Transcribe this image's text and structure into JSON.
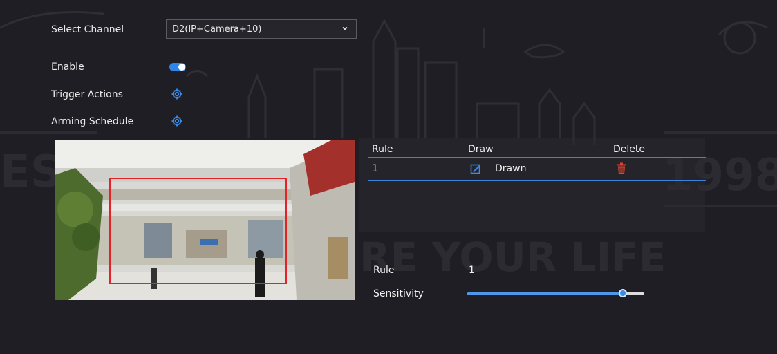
{
  "form": {
    "select_channel_label": "Select Channel",
    "channel_value": "D2(IP+Camera+10)",
    "enable_label": "Enable",
    "enable_on": true,
    "trigger_actions_label": "Trigger Actions",
    "arming_schedule_label": "Arming Schedule"
  },
  "rules_table": {
    "headers": {
      "rule": "Rule",
      "draw": "Draw",
      "delete": "Delete"
    },
    "rows": [
      {
        "rule": "1",
        "draw_status": "Drawn"
      }
    ]
  },
  "rule_settings": {
    "rule_label": "Rule",
    "rule_value": "1",
    "sensitivity_label": "Sensitivity",
    "sensitivity_level": 0.88
  },
  "watermark": {
    "left_text": "EST",
    "right_text": "1998",
    "center_text": "RE YOUR LIFE"
  },
  "colors": {
    "accent": "#2f86e6",
    "delete_icon": "#e0452f",
    "detection_box": "#e2232a"
  },
  "icons": {
    "select_chevron": "chevron-down-icon",
    "trigger_actions": "gear-icon",
    "arming_schedule": "gear-icon",
    "draw": "edit-icon",
    "delete": "trash-icon"
  }
}
